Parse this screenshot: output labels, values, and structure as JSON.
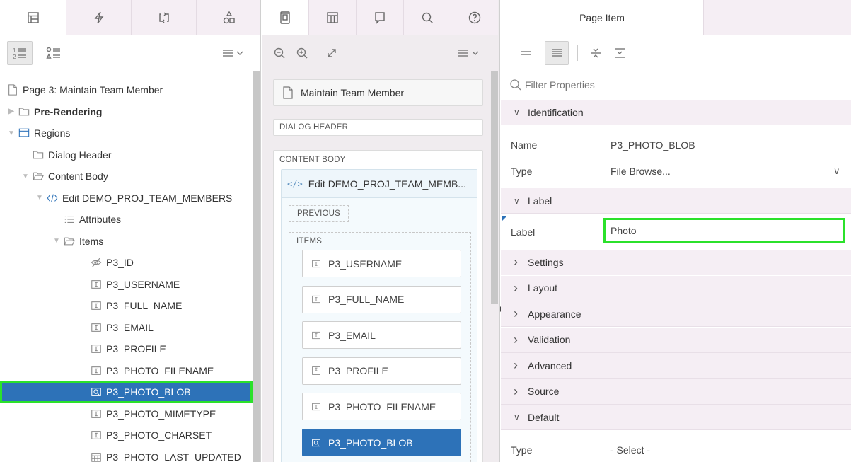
{
  "left": {
    "tabs": [
      "rendering-tab-icon",
      "dynamic-actions-tab-icon",
      "processing-tab-icon",
      "shared-components-tab-icon"
    ],
    "tree": [
      {
        "label": "Page 3: Maintain Team Member",
        "indent": 0,
        "icon": "page-icon",
        "toggle": ""
      },
      {
        "label": "Pre-Rendering",
        "indent": 0,
        "icon": "folder-icon",
        "toggle": "▶",
        "bold": true
      },
      {
        "label": "Regions",
        "indent": 0,
        "icon": "region-icon",
        "toggle": "▼"
      },
      {
        "label": "Dialog Header",
        "indent": 1,
        "icon": "folder-icon",
        "toggle": ""
      },
      {
        "label": "Content Body",
        "indent": 1,
        "icon": "folder-open-icon",
        "toggle": "▼"
      },
      {
        "label": "Edit DEMO_PROJ_TEAM_MEMBERS",
        "indent": 2,
        "icon": "code-icon",
        "toggle": "▼"
      },
      {
        "label": "Attributes",
        "indent": 3,
        "icon": "attributes-icon",
        "toggle": ""
      },
      {
        "label": "Items",
        "indent": 3,
        "icon": "folder-open-icon",
        "toggle": "▼"
      },
      {
        "label": "P3_ID",
        "indent": 4,
        "icon": "hidden-icon",
        "toggle": ""
      },
      {
        "label": "P3_USERNAME",
        "indent": 4,
        "icon": "text-field-icon",
        "toggle": ""
      },
      {
        "label": "P3_FULL_NAME",
        "indent": 4,
        "icon": "text-field-icon",
        "toggle": ""
      },
      {
        "label": "P3_EMAIL",
        "indent": 4,
        "icon": "text-field-icon",
        "toggle": ""
      },
      {
        "label": "P3_PROFILE",
        "indent": 4,
        "icon": "text-field-icon",
        "toggle": ""
      },
      {
        "label": "P3_PHOTO_FILENAME",
        "indent": 4,
        "icon": "text-field-icon",
        "toggle": ""
      },
      {
        "label": "P3_PHOTO_BLOB",
        "indent": 4,
        "icon": "file-browse-icon",
        "toggle": "",
        "selected": true
      },
      {
        "label": "P3_PHOTO_MIMETYPE",
        "indent": 4,
        "icon": "text-field-icon",
        "toggle": ""
      },
      {
        "label": "P3_PHOTO_CHARSET",
        "indent": 4,
        "icon": "text-field-icon",
        "toggle": ""
      },
      {
        "label": "P3_PHOTO_LAST_UPDATED",
        "indent": 4,
        "icon": "date-picker-icon",
        "toggle": ""
      }
    ]
  },
  "middle": {
    "page_title": "Maintain Team Member",
    "dialog_header": "DIALOG HEADER",
    "content_body": "CONTENT BODY",
    "region_title": "Edit DEMO_PROJ_TEAM_MEMB...",
    "previous": "PREVIOUS",
    "items_caption": "ITEMS",
    "items": [
      {
        "label": "P3_USERNAME",
        "icon": "text-field-icon"
      },
      {
        "label": "P3_FULL_NAME",
        "icon": "text-field-icon"
      },
      {
        "label": "P3_EMAIL",
        "icon": "text-field-icon"
      },
      {
        "label": "P3_PROFILE",
        "icon": "textarea-icon"
      },
      {
        "label": "P3_PHOTO_FILENAME",
        "icon": "text-field-icon"
      },
      {
        "label": "P3_PHOTO_BLOB",
        "icon": "file-browse-icon",
        "selected": true
      }
    ]
  },
  "right": {
    "tab_title": "Page Item",
    "filter_placeholder": "Filter Properties",
    "identification": "Identification",
    "name_label": "Name",
    "name_value": "P3_PHOTO_BLOB",
    "type_label": "Type",
    "type_value": "File Browse...",
    "label_section": "Label",
    "label_label": "Label",
    "label_value": "Photo",
    "sections": [
      "Settings",
      "Layout",
      "Appearance",
      "Validation",
      "Advanced",
      "Source"
    ],
    "default_section": "Default",
    "default_type_label": "Type",
    "default_type_value": "- Select -"
  },
  "colors": {
    "accent": "#2d72b8",
    "highlight": "#2be12b",
    "section_bg": "#f5eef4"
  }
}
